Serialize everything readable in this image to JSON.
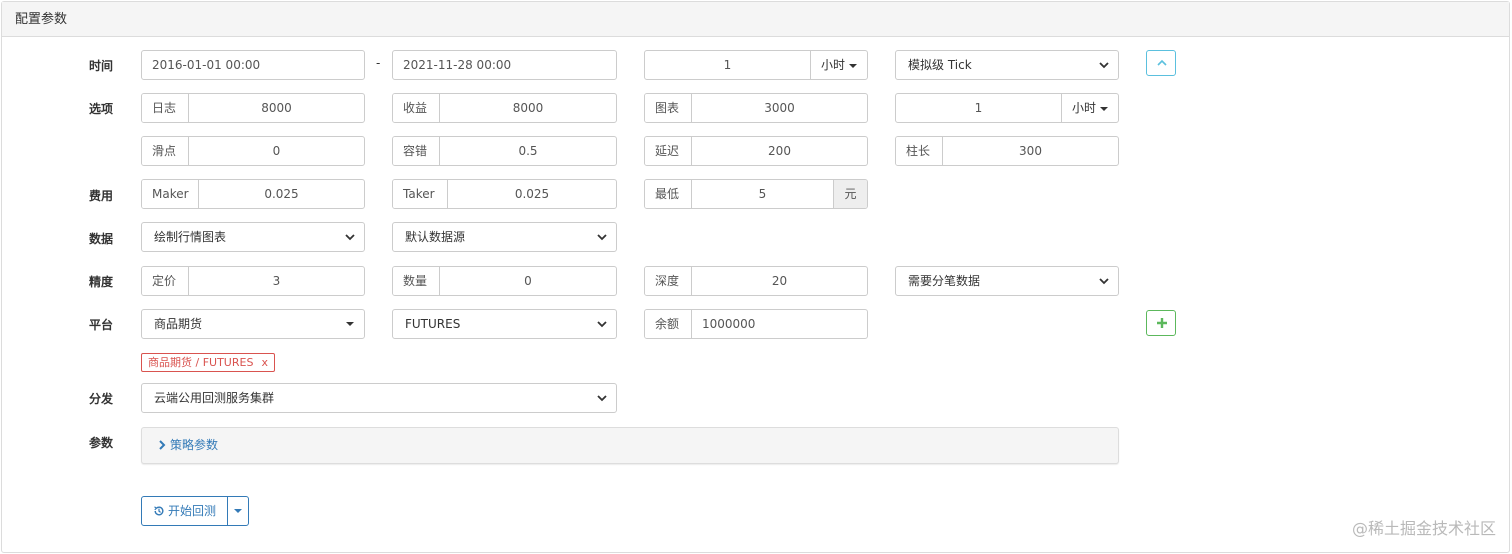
{
  "panel": {
    "title": "配置参数"
  },
  "labels": {
    "time": "时间",
    "options": "选项",
    "fees": "费用",
    "data": "数据",
    "precision": "精度",
    "platform": "平台",
    "dispatch": "分发",
    "params": "参数"
  },
  "time": {
    "start": "2016-01-01 00:00",
    "separator": "-",
    "end": "2021-11-28 00:00",
    "period_value": "1",
    "period_unit": "小时",
    "mode": "模拟级 Tick"
  },
  "options": {
    "log_label": "日志",
    "log_value": "8000",
    "profit_label": "收益",
    "profit_value": "8000",
    "chart_label": "图表",
    "chart_value": "3000",
    "kline_value": "1",
    "kline_unit": "小时",
    "slippage_label": "滑点",
    "slippage_value": "0",
    "tolerance_label": "容错",
    "tolerance_value": "0.5",
    "delay_label": "延迟",
    "delay_value": "200",
    "bar_len_label": "柱长",
    "bar_len_value": "300"
  },
  "fees": {
    "maker_label": "Maker",
    "maker_value": "0.025",
    "taker_label": "Taker",
    "taker_value": "0.025",
    "min_label": "最低",
    "min_value": "5",
    "min_unit": "元"
  },
  "data": {
    "chart_option": "绘制行情图表",
    "source_option": "默认数据源"
  },
  "precision": {
    "price_label": "定价",
    "price_value": "3",
    "amount_label": "数量",
    "amount_value": "0",
    "depth_label": "深度",
    "depth_value": "20",
    "trades_option": "需要分笔数据"
  },
  "platform": {
    "exchange": "商品期货",
    "contract": "FUTURES",
    "balance_label": "余额",
    "balance_value": "1000000",
    "tag_text": "商品期货 / FUTURES",
    "tag_remove": "x"
  },
  "dispatch": {
    "cluster": "云端公用回测服务集群"
  },
  "params": {
    "toggle_label": "策略参数"
  },
  "actions": {
    "start_label": "开始回测"
  },
  "watermark": "@稀土掘金技术社区",
  "colors": {
    "primary": "#337ab7",
    "success": "#5cb85c",
    "info": "#5bc0de",
    "danger": "#d9534f"
  }
}
